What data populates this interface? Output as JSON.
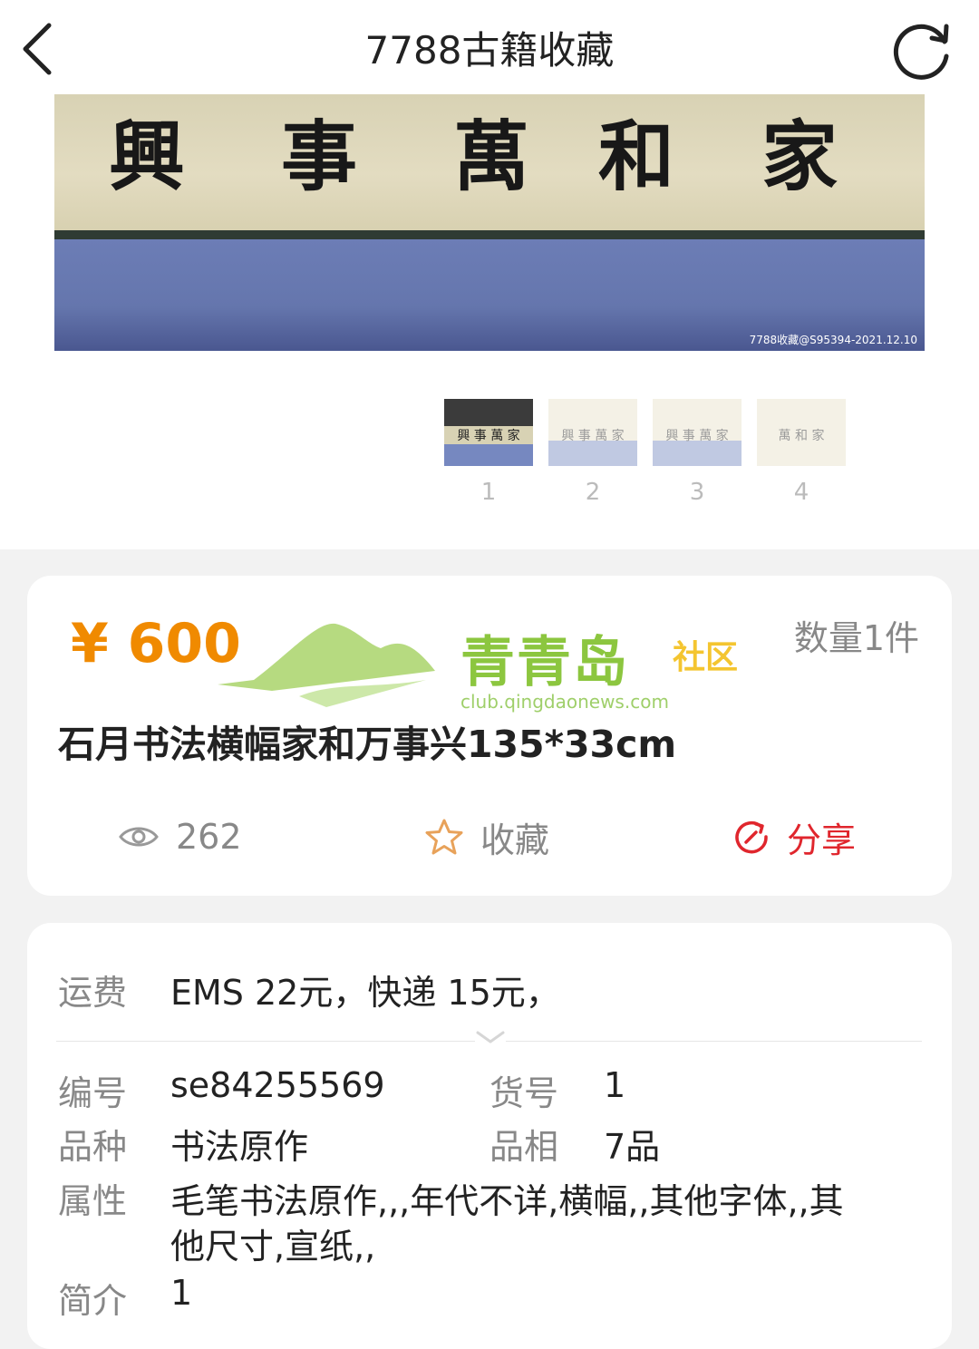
{
  "header": {
    "title": "7788古籍收藏"
  },
  "image": {
    "calligraphy": [
      "興",
      "事",
      "萬",
      "和",
      "家"
    ],
    "watermark": "7788收藏@S95394-2021.12.10"
  },
  "thumbnails": [
    {
      "number": "1"
    },
    {
      "number": "2"
    },
    {
      "number": "3"
    },
    {
      "number": "4"
    }
  ],
  "product": {
    "price": "¥ 600",
    "quantity": "数量1件",
    "name": "石月书法横幅家和万事兴135*33cm",
    "views": "262",
    "favorite_label": "收藏",
    "share_label": "分享"
  },
  "overlay_logo": {
    "text": "青青岛",
    "subtext": "社区",
    "url": "club.qingdaonews.com"
  },
  "details": {
    "shipping_label": "运费",
    "shipping_value": "EMS 22元，快递 15元，",
    "id_label": "编号",
    "id_value": "se84255569",
    "item_no_label": "货号",
    "item_no_value": "1",
    "category_label": "品种",
    "category_value": "书法原作",
    "condition_label": "品相",
    "condition_value": "7品",
    "attributes_label": "属性",
    "attributes_line1": "毛笔书法原作,,,年代不详,横幅,,其他字体,,其",
    "attributes_line2": "他尺寸,宣纸,,",
    "intro_label": "简介",
    "intro_value": "1"
  },
  "colors": {
    "price": "#f08a00",
    "share": "#e0262d",
    "favorite_star": "#e8a25a",
    "logo_green": "#8cc63f"
  }
}
